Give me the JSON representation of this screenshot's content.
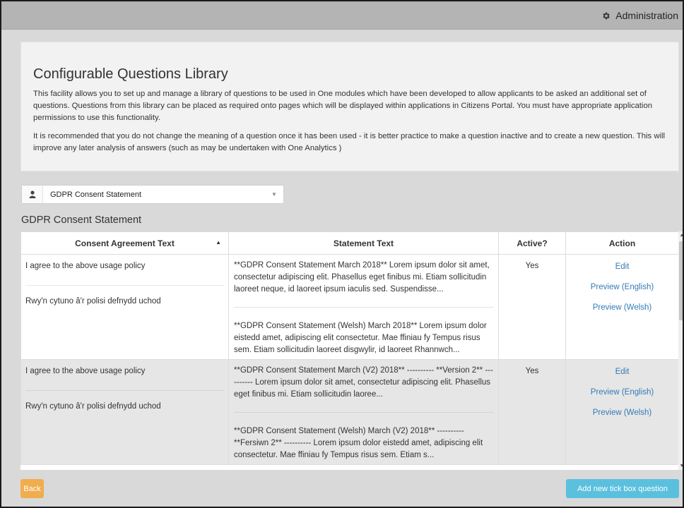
{
  "header": {
    "admin_label": "Administration",
    "admin_icon": "gear-icon"
  },
  "intro": {
    "title": "Configurable Questions Library",
    "paragraph1": "This facility allows you to set up and manage a library of questions to be used in One modules which have been developed to allow applicants to be asked an additional set of questions. Questions from this library can be placed as required onto pages which will be displayed within applications in Citizens Portal. You must have appropriate application permissions to use this functionality.",
    "paragraph2": "It is recommended that you do not change the meaning of a question once it has been used - it is better practice to make a question inactive and to create a new question. This will improve any later analysis of answers (such as may be undertaken with One Analytics )"
  },
  "selector": {
    "icon": "person-icon",
    "value": "GDPR Consent Statement"
  },
  "section_title": "GDPR Consent Statement",
  "table": {
    "headers": [
      "Consent Agreement Text",
      "Statement Text",
      "Active?",
      "Action"
    ],
    "rows": [
      {
        "agree_en": "I agree to the above usage policy",
        "agree_cy": "Rwy'n cytuno â'r polisi defnydd uchod",
        "stmt_en": "**GDPR Consent Statement March 2018** Lorem ipsum dolor sit amet, consectetur adipiscing elit. Phasellus eget finibus mi. Etiam sollicitudin laoreet neque, id laoreet ipsum iaculis sed. Suspendisse...",
        "stmt_cy": "**GDPR Consent Statement (Welsh) March 2018** Lorem ipsum dolor eistedd amet, adipiscing elit consectetur. Mae ffiniau fy Tempus risus sem. Etiam sollicitudin laoreet disgwylir, id laoreet Rhannwch...",
        "active": "Yes",
        "actions": [
          "Edit",
          "Preview (English)",
          "Preview (Welsh)"
        ]
      },
      {
        "agree_en": "I agree to the above usage policy",
        "agree_cy": "Rwy'n cytuno â'r polisi defnydd uchod",
        "stmt_en": "**GDPR Consent Statement March (V2) 2018** ---------- **Version 2** ---------- Lorem ipsum dolor sit amet, consectetur adipiscing elit. Phasellus eget finibus mi. Etiam sollicitudin laoree...",
        "stmt_cy": "**GDPR Consent Statement (Welsh) March (V2) 2018** ---------- **Fersiwn 2** ---------- Lorem ipsum dolor eistedd amet, adipiscing elit consectetur. Mae ffiniau fy Tempus risus sem. Etiam s...",
        "active": "Yes",
        "actions": [
          "Edit",
          "Preview (English)",
          "Preview (Welsh)"
        ]
      }
    ]
  },
  "buttons": {
    "back": "Back",
    "add": "Add new tick box question"
  },
  "colors": {
    "back_button": "#f0ad4e",
    "add_button": "#5bc0de",
    "link": "#337ab7"
  }
}
